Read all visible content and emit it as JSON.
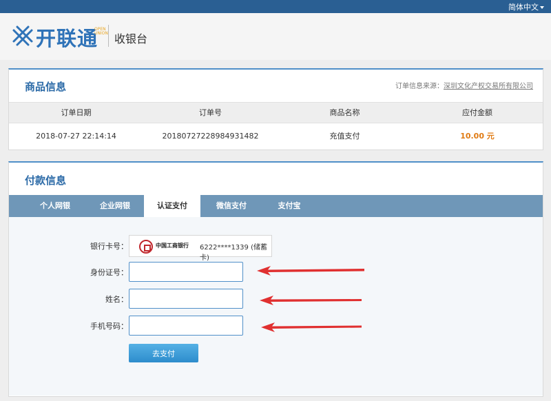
{
  "topbar": {
    "language": "简体中文"
  },
  "header": {
    "logo_text": "开联通",
    "logo_sub": "OPEN UNION",
    "title": "收银台"
  },
  "goods": {
    "title": "商品信息",
    "source_label": "订单信息来源：",
    "source_link": "深圳文化产权交易所有限公司",
    "columns": [
      "订单日期",
      "订单号",
      "商品名称",
      "应付金额"
    ],
    "row": {
      "date": "2018-07-27 22:14:14",
      "order_no": "20180727228984931482",
      "product": "充值支付",
      "amount": "10.00  元"
    }
  },
  "payment": {
    "title": "付款信息",
    "tabs": [
      {
        "label": "个人网银"
      },
      {
        "label": "企业网银"
      },
      {
        "label": "认证支付"
      },
      {
        "label": "微信支付"
      },
      {
        "label": "支付宝"
      }
    ],
    "active_tab": 2,
    "form": {
      "card_label": "银行卡号：",
      "bank_name": "中国工商银行",
      "card_number": "6222****1339 (储蓄卡)",
      "id_label": "身份证号：",
      "id_value": "",
      "name_label": "姓名：",
      "name_value": "",
      "phone_label": "手机号码：",
      "phone_value": "",
      "submit_label": "去支付"
    }
  },
  "colors": {
    "topbar": "#2a5f93",
    "accent": "#2b6aa7",
    "tab_bar": "#6f97b8",
    "amount": "#e07a12",
    "arrow": "#e03030",
    "button": "#3c9cd6"
  },
  "icons": [
    "kailiantong-logo-icon",
    "icbc-logo-icon",
    "chevron-down-icon",
    "red-arrow-annotation"
  ]
}
